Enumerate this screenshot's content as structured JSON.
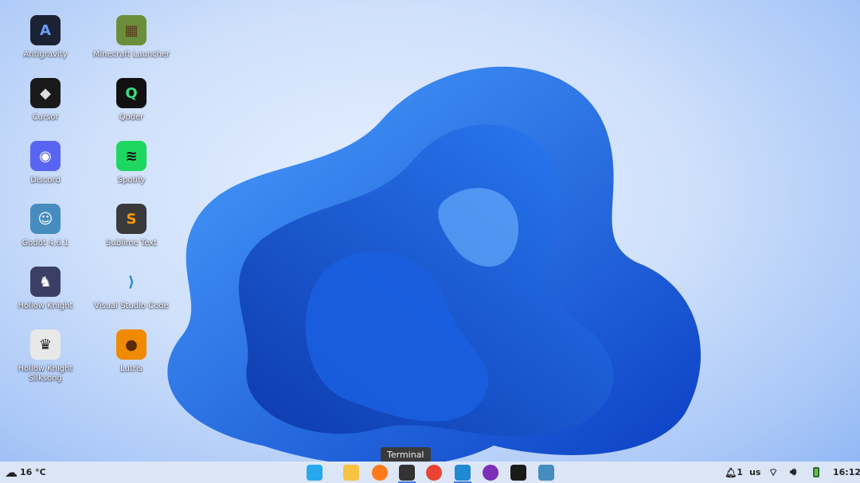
{
  "desktop": {
    "icons": [
      {
        "label": "Antigravity",
        "color": "#1b2233",
        "glyph": "A",
        "fg": "#6aa0ff"
      },
      {
        "label": "Minecraft Launcher",
        "color": "#6b8e3a",
        "glyph": "▦",
        "fg": "#5a3b22"
      },
      {
        "label": "Cursor",
        "color": "#1a1a1a",
        "glyph": "◆",
        "fg": "#ddd"
      },
      {
        "label": "Qoder",
        "color": "#111",
        "glyph": "Q",
        "fg": "#3ddc84"
      },
      {
        "label": "Discord",
        "color": "#5865f2",
        "glyph": "◉",
        "fg": "#fff"
      },
      {
        "label": "Spotify",
        "color": "#1ed760",
        "glyph": "≋",
        "fg": "#111"
      },
      {
        "label": "Godot 4.6.1",
        "color": "#478cbf",
        "glyph": "☺",
        "fg": "#fff"
      },
      {
        "label": "Sublime Text",
        "color": "#3a3a3a",
        "glyph": "S",
        "fg": "#ff9800"
      },
      {
        "label": "Hollow Knight",
        "color": "#3b3f66",
        "glyph": "♞",
        "fg": "#fff"
      },
      {
        "label": "Visual Studio Code",
        "color": "transparent",
        "glyph": "⟩",
        "fg": "#1f8ad2"
      },
      {
        "label": "Hollow Knight Silksong",
        "color": "#e8e8e8",
        "glyph": "♛",
        "fg": "#222"
      },
      {
        "label": "Lutris",
        "color": "#f08a00",
        "glyph": "●",
        "fg": "#5a2a00"
      }
    ]
  },
  "taskbar": {
    "weather": "16 °C",
    "tooltip": "Terminal",
    "apps": [
      {
        "name": "start-menu",
        "color": "#29a8f0",
        "active": false
      },
      {
        "name": "files",
        "color": "#f6c342",
        "active": false
      },
      {
        "name": "firefox",
        "color": "#ff7a1a",
        "active": false
      },
      {
        "name": "terminal",
        "color": "#333",
        "active": true
      },
      {
        "name": "chrome",
        "color": "#e84335",
        "active": false
      },
      {
        "name": "vscode",
        "color": "#1f8ad2",
        "active": true
      },
      {
        "name": "tor-browser",
        "color": "#7d2fb8",
        "active": false
      },
      {
        "name": "cursor",
        "color": "#1a1a1a",
        "active": false
      },
      {
        "name": "godot",
        "color": "#478cbf",
        "active": false
      }
    ],
    "notifications": "1",
    "keyboard": "us",
    "clock": "16:12"
  }
}
